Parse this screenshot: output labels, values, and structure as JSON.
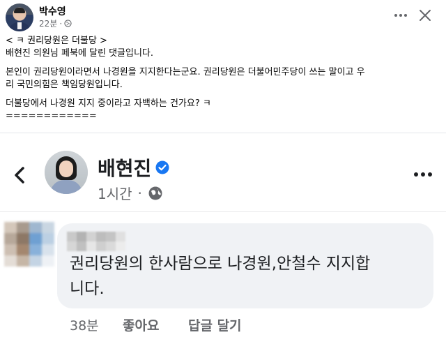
{
  "post": {
    "author": "박수영",
    "time": "22분",
    "lines": [
      "< ㅋ 권리당원은 더불당 >",
      "배현진 의원님 페북에 달린 댓글입니다.",
      "",
      "본인이 권리당원이라면서 나경원을 지지한다는군요. 권리당원은 더불어민주당이 쓰는 말이고 우",
      "리 국민의힘은 책임당원입니다.",
      "",
      "더불당에서 나경원 지지 중이라고 자백하는 건가요? ㅋ",
      "============"
    ]
  },
  "screenshot": {
    "author": "배현진",
    "time": "1시간",
    "dot": "·",
    "comment": {
      "text_line1": "권리당원의 한사람으로 나경원,안철수 지지합",
      "text_line2": "니다."
    },
    "actions": {
      "time": "38분",
      "like": "좋아요",
      "reply": "답글 달기"
    }
  },
  "colors": {
    "accent": "#1877f2",
    "muted": "#65676b",
    "bubble": "#f0f2f5"
  }
}
